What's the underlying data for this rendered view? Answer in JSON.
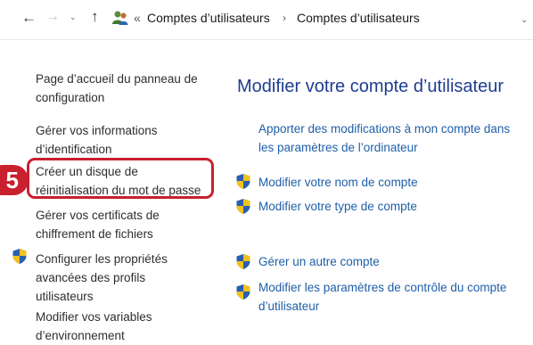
{
  "address_bar": {
    "back_icon": "arrow-left-icon",
    "forward_icon": "arrow-right-icon",
    "recent_icon": "chevron-down-icon",
    "up_icon": "arrow-up-icon",
    "location_icon": "users-icon",
    "overflow_marker": "«",
    "breadcrumbs": [
      {
        "label": "Comptes d’utilisateurs"
      },
      {
        "label": "Comptes d’utilisateurs"
      }
    ],
    "separator": "›"
  },
  "sidebar": {
    "items": [
      {
        "label": "Page d’accueil du panneau de configuration"
      },
      {
        "label": "Gérer vos informations d’identification"
      },
      {
        "label": "Créer un disque de réinitialisation du mot de passe"
      },
      {
        "label": "Gérer vos certificats de chiffrement de fichiers"
      },
      {
        "label": "Configurer les propriétés avancées des profils utilisateurs",
        "icon": "uac-shield-icon"
      },
      {
        "label": "Modifier vos variables d’environnement"
      }
    ]
  },
  "callout": {
    "step_number": "5",
    "color": "#c8202f"
  },
  "main": {
    "title": "Modifier votre compte d’utilisateur",
    "links": [
      {
        "label": "Apporter des modifications à mon compte dans les paramètres de l’ordinateur"
      },
      {
        "label": "Modifier votre nom de compte",
        "icon": "uac-shield-icon"
      },
      {
        "label": "Modifier votre type de compte",
        "icon": "uac-shield-icon"
      },
      {
        "label": "Gérer un autre compte",
        "icon": "uac-shield-icon"
      },
      {
        "label": "Modifier les paramètres de contrôle du compte d’utilisateur",
        "icon": "uac-shield-icon"
      }
    ]
  },
  "colors": {
    "title": "#1e3d8f",
    "link": "#1f5ea8",
    "side_text": "#2d2d2d",
    "shield_blue": "#2a5fb0",
    "shield_yellow": "#f2c21b"
  }
}
